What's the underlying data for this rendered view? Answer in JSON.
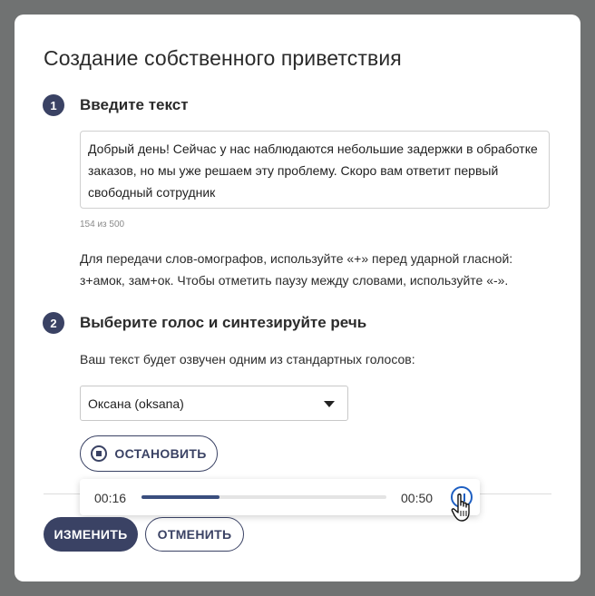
{
  "dialog": {
    "title": "Создание собственного приветствия"
  },
  "step1": {
    "number": "1",
    "title": "Введите текст",
    "text_value": "Добрый день! Сейчас у нас наблюдаются небольшие задержки в обработке заказов, но мы уже решаем эту проблему. Скоро вам ответит первый свободный сотрудник",
    "counter": "154 из 500",
    "hint": "Для передачи слов-омографов, используйте «+» перед ударной гласной: з+амок, зам+ок. Чтобы отметить паузу между словами, используйте «-»."
  },
  "step2": {
    "number": "2",
    "title": "Выберите голос и синтезируйте речь",
    "description": "Ваш текст будет озвучен одним из стандартных голосов:",
    "voice_selected": "Оксана (oksana)",
    "stop_label": "ОСТАНОВИТЬ"
  },
  "player": {
    "current_time": "00:16",
    "total_time": "00:50",
    "progress_fraction": 0.32
  },
  "footer": {
    "change_label": "ИЗМЕНИТЬ",
    "cancel_label": "ОТМЕНИТЬ"
  },
  "icons": {
    "stop": "stop-circle-icon",
    "pause": "pause-circle-icon",
    "dropdown": "caret-down-icon",
    "cursor": "hand-pointer-icon"
  },
  "colors": {
    "primary": "#3a4264",
    "overlay": "#707272",
    "player_accent": "#1e5fc2"
  }
}
